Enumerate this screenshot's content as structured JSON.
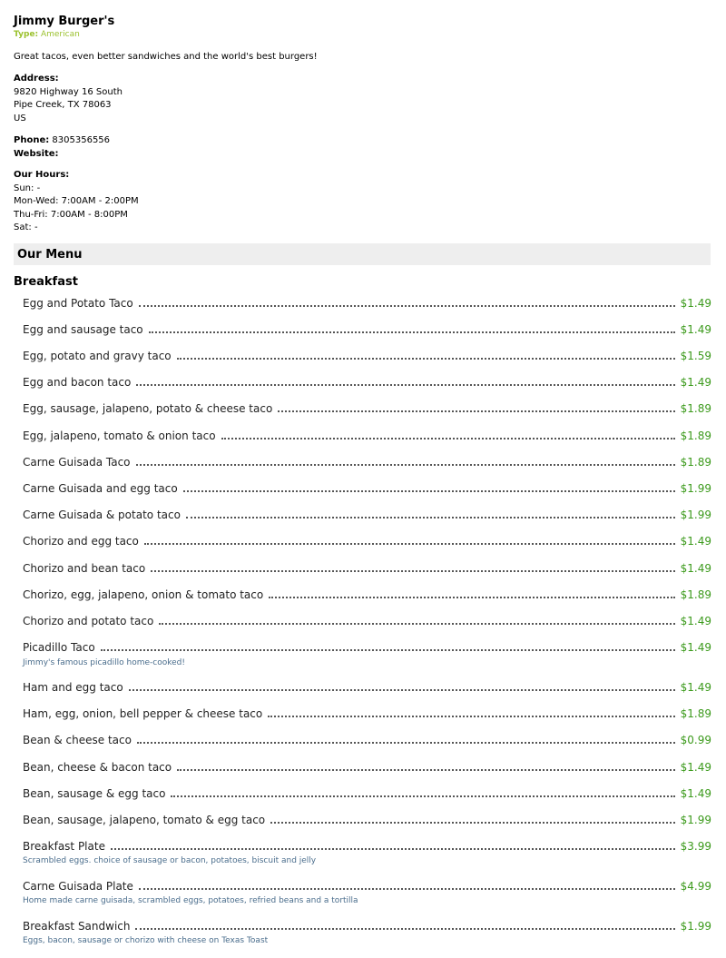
{
  "restaurant": {
    "name": "Jimmy Burger's",
    "type_label": "Type:",
    "type_value": "American",
    "description": "Great tacos, even better sandwiches and the world's best burgers!",
    "address_label": "Address:",
    "address_lines": [
      "9820 Highway 16 South",
      "Pipe Creek, TX 78063",
      "US"
    ],
    "phone_label": "Phone:",
    "phone": "8305356556",
    "website_label": "Website:",
    "hours_label": "Our Hours:",
    "hours": [
      "Sun: -",
      "Mon-Wed: 7:00AM - 2:00PM",
      "Thu-Fri: 7:00AM - 8:00PM",
      "Sat: -"
    ]
  },
  "menu": {
    "title": "Our Menu",
    "category": "Breakfast",
    "items": [
      {
        "name": "Egg and Potato Taco",
        "price": "$1.49"
      },
      {
        "name": "Egg and sausage taco",
        "price": "$1.49"
      },
      {
        "name": "Egg, potato and gravy taco",
        "price": "$1.59"
      },
      {
        "name": "Egg and bacon taco",
        "price": "$1.49"
      },
      {
        "name": "Egg, sausage, jalapeno, potato & cheese taco",
        "price": "$1.89"
      },
      {
        "name": "Egg, jalapeno, tomato & onion taco",
        "price": "$1.89"
      },
      {
        "name": "Carne Guisada Taco",
        "price": "$1.89"
      },
      {
        "name": "Carne Guisada and egg taco",
        "price": "$1.99"
      },
      {
        "name": "Carne Guisada & potato taco",
        "price": "$1.99"
      },
      {
        "name": "Chorizo and egg taco",
        "price": "$1.49"
      },
      {
        "name": "Chorizo and bean taco",
        "price": "$1.49"
      },
      {
        "name": "Chorizo, egg, jalapeno, onion & tomato taco",
        "price": "$1.89"
      },
      {
        "name": "Chorizo and potato taco",
        "price": "$1.49"
      },
      {
        "name": "Picadillo Taco",
        "price": "$1.49",
        "description": "Jimmy's famous picadillo home-cooked!"
      },
      {
        "name": "Ham and egg taco",
        "price": "$1.49"
      },
      {
        "name": "Ham, egg, onion, bell pepper & cheese taco",
        "price": "$1.89"
      },
      {
        "name": "Bean & cheese taco",
        "price": "$0.99"
      },
      {
        "name": "Bean, cheese & bacon taco",
        "price": "$1.49"
      },
      {
        "name": "Bean, sausage & egg taco",
        "price": "$1.49"
      },
      {
        "name": "Bean, sausage, jalapeno, tomato & egg taco",
        "price": "$1.99"
      },
      {
        "name": "Breakfast Plate",
        "price": "$3.99",
        "description": "Scrambled eggs. choice of sausage or bacon, potatoes, biscuit and jelly"
      },
      {
        "name": "Carne Guisada Plate",
        "price": "$4.99",
        "description": "Home made carne guisada, scrambled eggs, potatoes, refried beans and a tortilla"
      },
      {
        "name": "Breakfast Sandwich",
        "price": "$1.99",
        "description": "Eggs, bacon, sausage or chorizo with cheese on Texas Toast"
      }
    ]
  }
}
